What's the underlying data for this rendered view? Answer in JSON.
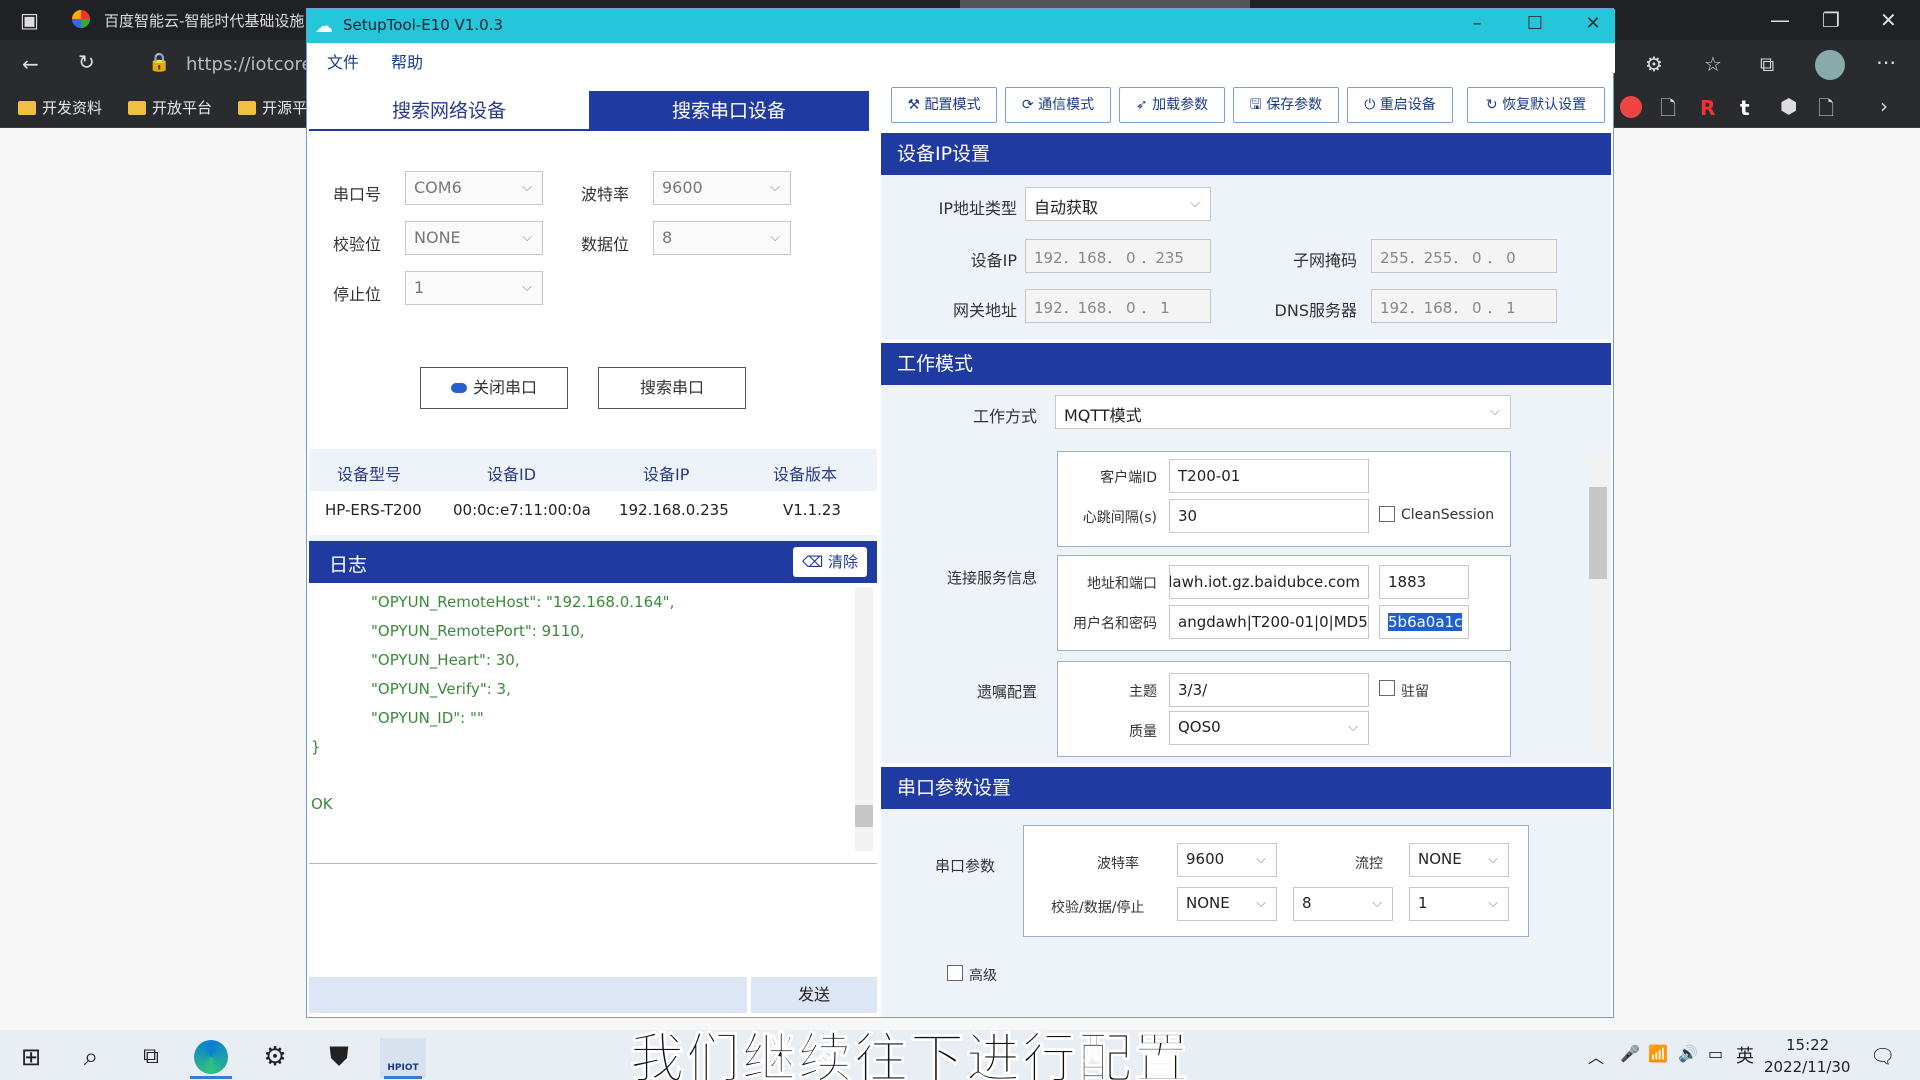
{
  "browser": {
    "tab_title": "百度智能云-智能时代基础设施",
    "address": "https://iotcore-",
    "bookmarks": [
      "开发资料",
      "开放平台",
      "开源平"
    ]
  },
  "app": {
    "title": "SetupTool-E10 V1.0.3",
    "menu": [
      "文件",
      "帮助"
    ],
    "left_tabs": [
      "搜索网络设备",
      "搜索串口设备"
    ],
    "serial": {
      "port_label": "串口号",
      "port_value": "COM6",
      "baud_label": "波特率",
      "baud_value": "9600",
      "parity_label": "校验位",
      "parity_value": "NONE",
      "databits_label": "数据位",
      "databits_value": "8",
      "stopbits_label": "停止位",
      "stopbits_value": "1",
      "close_port_btn": "关闭串口",
      "search_port_btn": "搜索串口"
    },
    "device_table": {
      "headers": [
        "设备型号",
        "设备ID",
        "设备IP",
        "设备版本"
      ],
      "row": [
        "HP-ERS-T200",
        "00:0c:e7:11:00:0a",
        "192.168.0.235",
        "V1.1.23"
      ]
    },
    "log": {
      "title": "日志",
      "clear_btn": "清除",
      "lines": [
        "\"OPYUN_RemoteHost\":   \"192.168.0.164\",",
        "\"OPYUN_RemotePort\":    9110,",
        "\"OPYUN_Heart\": 30,",
        "\"OPYUN_Verify\": 3,",
        "\"OPYUN_ID\":       \"\"",
        "}",
        "OK"
      ],
      "send_btn": "发送"
    },
    "toolbar": [
      "配置模式",
      "通信模式",
      "加载参数",
      "保存参数",
      "重启设备",
      "恢复默认设置"
    ],
    "ip_section": {
      "title": "设备IP设置",
      "ip_type_label": "IP地址类型",
      "ip_type_value": "自动获取",
      "device_ip_label": "设备IP",
      "device_ip_value": "192．168． 0 ．235",
      "mask_label": "子网掩码",
      "mask_value": "255．255． 0 ． 0",
      "gateway_label": "网关地址",
      "gateway_value": "192．168． 0 ． 1",
      "dns_label": "DNS服务器",
      "dns_value": "192．168． 0 ． 1"
    },
    "work_mode": {
      "title": "工作模式",
      "mode_label": "工作方式",
      "mode_value": "MQTT模式",
      "client_id_label": "客户端ID",
      "client_id_value": "T200-01",
      "heartbeat_label": "心跳间隔(s)",
      "heartbeat_value": "30",
      "clean_session_label": "CleanSession",
      "server_label": "连接服务信息",
      "addr_port_label": "地址和端口",
      "addr_value": "dawh.iot.gz.baidubce.com",
      "port_value": "1883",
      "user_pass_label": "用户名和密码",
      "user_value": "angdawh|T200-01|0|MD5",
      "pass_value": "5b6a0a1c",
      "will_label": "遗嘱配置",
      "topic_label": "主题",
      "topic_value": "3/3/",
      "retain_label": "驻留",
      "qos_label": "质量",
      "qos_value": "QOS0"
    },
    "serial_params": {
      "title": "串口参数设置",
      "group_label": "串口参数",
      "baud_label": "波特率",
      "baud_value": "9600",
      "flow_label": "流控",
      "flow_value": "NONE",
      "pds_label": "校验/数据/停止",
      "parity_value": "NONE",
      "data_value": "8",
      "stop_value": "1",
      "advanced_label": "高级"
    }
  },
  "taskbar": {
    "time": "15:22",
    "date": "2022/11/30",
    "ime": "英",
    "hpiot": "HPIOT"
  },
  "subtitle": "我们继续往下进行配置"
}
